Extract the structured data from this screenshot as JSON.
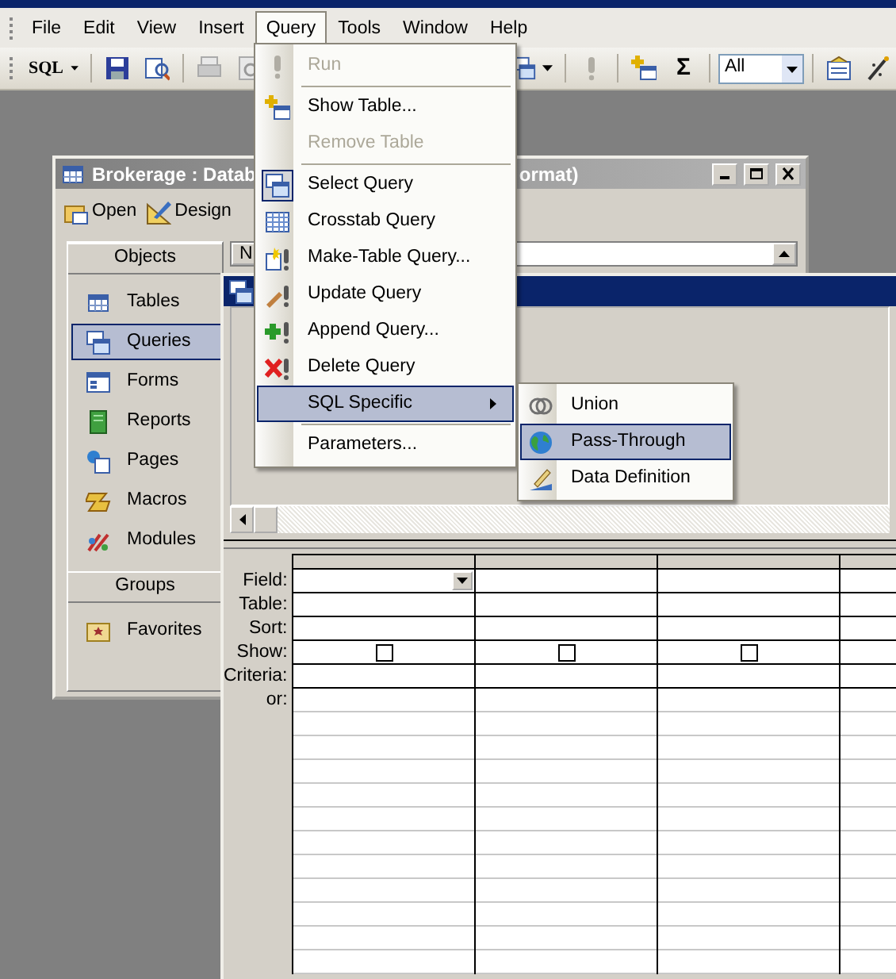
{
  "menu_bar": [
    {
      "label": "File",
      "selected": false
    },
    {
      "label": "Edit",
      "selected": false
    },
    {
      "label": "View",
      "selected": false
    },
    {
      "label": "Insert",
      "selected": false
    },
    {
      "label": "Query",
      "selected": true
    },
    {
      "label": "Tools",
      "selected": false
    },
    {
      "label": "Window",
      "selected": false
    },
    {
      "label": "Help",
      "selected": false
    }
  ],
  "toolbar": {
    "view_button": "SQL",
    "sum_button": "Σ",
    "top_values": "All"
  },
  "database_window": {
    "title_left": "Brokerage : Datab",
    "title_right": "ormat)",
    "buttons": [
      "Open",
      "Design"
    ],
    "list_header": "N",
    "objects_header": "Objects",
    "objects": [
      {
        "label": "Tables",
        "selected": false
      },
      {
        "label": "Queries",
        "selected": true
      },
      {
        "label": "Forms",
        "selected": false
      },
      {
        "label": "Reports",
        "selected": false
      },
      {
        "label": "Pages",
        "selected": false
      },
      {
        "label": "Macros",
        "selected": false
      },
      {
        "label": "Modules",
        "selected": false
      }
    ],
    "groups_header": "Groups",
    "groups": [
      "Favorites"
    ]
  },
  "query_window": {
    "grid": {
      "row_labels": [
        "Field:",
        "Table:",
        "Sort:",
        "Show:",
        "Criteria:",
        "or:"
      ],
      "columns": [
        {
          "show": false
        },
        {
          "show": false
        },
        {
          "show": false
        }
      ]
    }
  },
  "query_menu": [
    {
      "kind": "item",
      "label": "Run",
      "disabled": true,
      "checked": false,
      "selected": false
    },
    {
      "kind": "separator"
    },
    {
      "kind": "item",
      "label": "Show Table...",
      "disabled": false,
      "checked": false,
      "selected": false
    },
    {
      "kind": "item",
      "label": "Remove Table",
      "disabled": true,
      "selected": false
    },
    {
      "kind": "separator"
    },
    {
      "kind": "item",
      "label": "Select Query",
      "disabled": false,
      "checked": true,
      "selected": false
    },
    {
      "kind": "item",
      "label": "Crosstab Query",
      "disabled": false,
      "checked": false,
      "selected": false
    },
    {
      "kind": "item",
      "label": "Make-Table Query...",
      "disabled": false,
      "checked": false,
      "selected": false
    },
    {
      "kind": "item",
      "label": "Update Query",
      "disabled": false,
      "checked": false,
      "selected": false
    },
    {
      "kind": "item",
      "label": "Append Query...",
      "disabled": false,
      "checked": false,
      "selected": false
    },
    {
      "kind": "item",
      "label": "Delete Query",
      "disabled": false,
      "checked": false,
      "selected": false
    },
    {
      "kind": "submenu",
      "label": "SQL Specific",
      "disabled": false,
      "selected": true
    },
    {
      "kind": "separator"
    },
    {
      "kind": "item",
      "label": "Parameters...",
      "disabled": false,
      "selected": false
    }
  ],
  "sql_submenu": [
    {
      "label": "Union",
      "selected": false
    },
    {
      "label": "Pass-Through",
      "selected": true
    },
    {
      "label": "Data Definition",
      "selected": false
    }
  ]
}
